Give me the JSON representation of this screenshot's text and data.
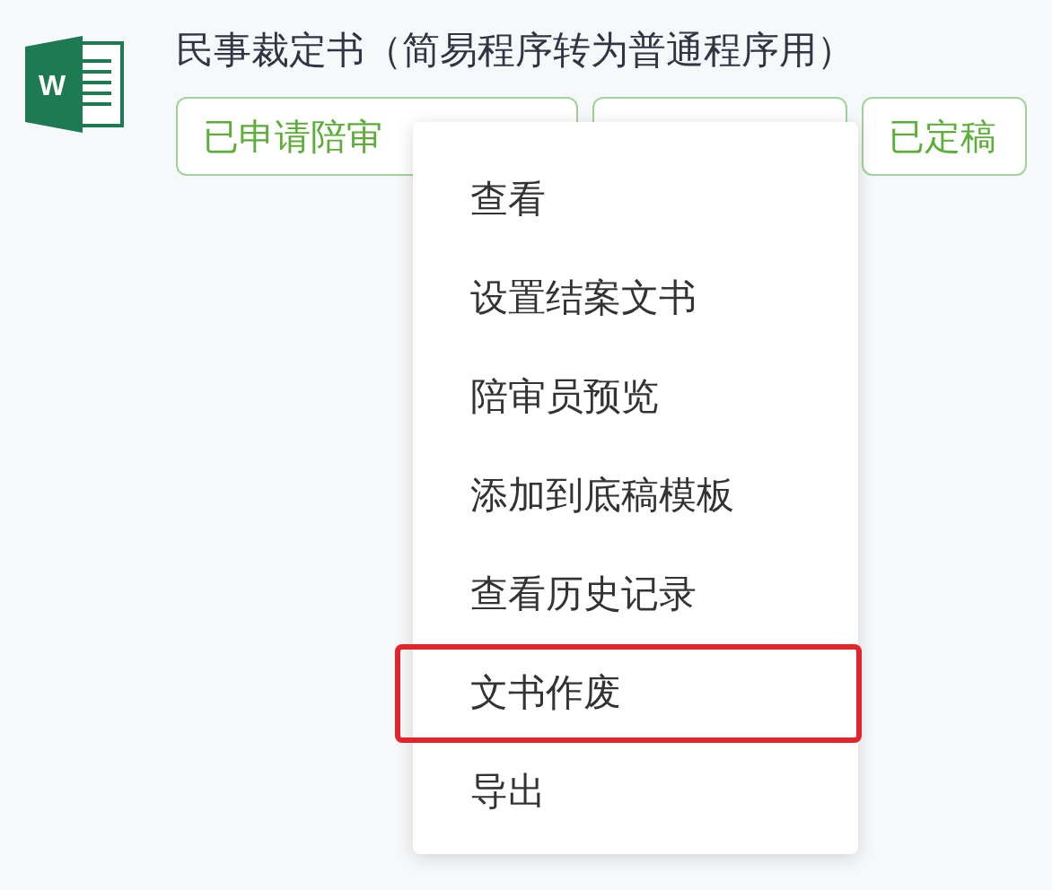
{
  "document": {
    "icon_letter": "W",
    "title": "民事裁定书（简易程序转为普通程序用）",
    "tags": [
      {
        "kind": "text",
        "text": "已申请陪审"
      },
      {
        "kind": "covered"
      },
      {
        "kind": "text",
        "text": "已定稿"
      }
    ]
  },
  "context_menu": {
    "items": [
      {
        "label": "查看",
        "selected": false
      },
      {
        "label": "设置结案文书",
        "selected": false
      },
      {
        "label": "陪审员预览",
        "selected": false
      },
      {
        "label": "添加到底稿模板",
        "selected": false
      },
      {
        "label": "查看历史记录",
        "selected": false
      },
      {
        "label": "文书作废",
        "selected": true
      },
      {
        "label": "导出",
        "selected": false
      }
    ]
  }
}
